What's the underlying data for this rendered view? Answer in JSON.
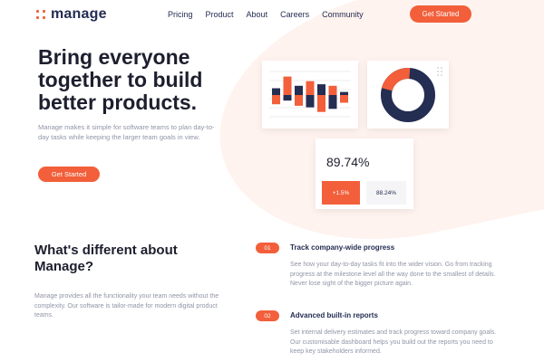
{
  "header": {
    "logo_text": "manage",
    "nav": [
      "Pricing",
      "Product",
      "About",
      "Careers",
      "Community"
    ],
    "cta_label": "Get Started"
  },
  "hero": {
    "title_lines": [
      "Bring everyone",
      "together to build",
      "better products."
    ],
    "description": "Manage makes it simple for software teams to plan day-to-day tasks while keeping the larger team goals in view.",
    "cta_label": "Get Started"
  },
  "dashboard": {
    "bars": [
      {
        "navy": 0.22,
        "orange": 0.3
      },
      {
        "navy": 0.6,
        "orange": 0.18
      },
      {
        "navy": 0.3,
        "orange": 0.35
      },
      {
        "navy": 0.45,
        "orange": 0.4
      },
      {
        "navy": 0.35,
        "orange": 0.55
      },
      {
        "navy": 0.3,
        "orange": 0.45
      },
      {
        "navy": 0.1,
        "orange": 0.25
      }
    ],
    "donut": {
      "orange_fraction": 0.22
    },
    "stat_value": "89.74%",
    "chip_change": "+1.5%",
    "chip_value": "88.24%"
  },
  "section": {
    "title_lines": [
      "What's different about",
      "Manage?"
    ],
    "description": "Manage provides all the functionality your team needs without the complexity. Our software is tailor-made for modern digital product teams."
  },
  "features": [
    {
      "num": "01",
      "title": "Track company-wide progress",
      "text": "See how your day-to-day tasks fit into the wider vision. Go from tracking progress at the milestone level all the way done to the smallest of details. Never lose sight of the bigger picture again."
    },
    {
      "num": "02",
      "title": "Advanced built-in reports",
      "text": "Set internal delivery estimates and track progress toward company goals. Our customisable dashboard helps you build out the reports you need to keep key stakeholders informed."
    }
  ],
  "colors": {
    "accent": "#f25f3a",
    "navy": "#242d52",
    "muted": "#9095a7",
    "tint": "#fff3ef"
  }
}
